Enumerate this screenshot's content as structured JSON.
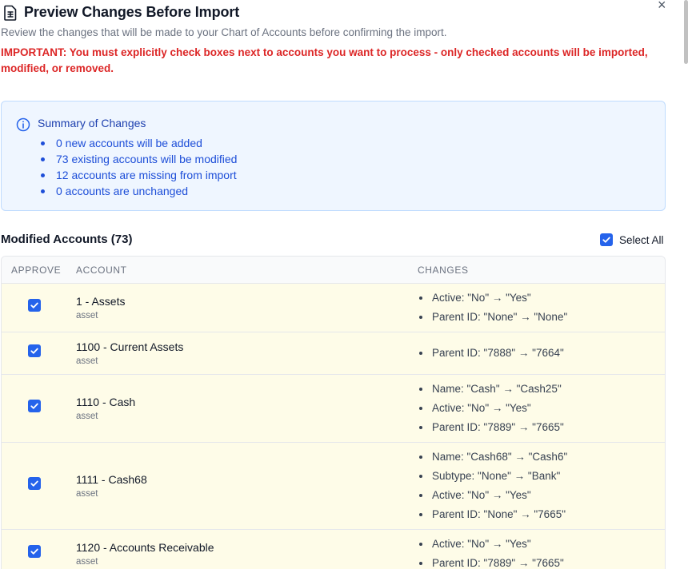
{
  "dialog": {
    "title": "Preview Changes Before Import",
    "close_label": "×",
    "subtitle": "Review the changes that will be made to your Chart of Accounts before confirming the import.",
    "important": "IMPORTANT: You must explicitly check boxes next to accounts you want to process - only checked accounts will be imported, modified, or removed."
  },
  "summary": {
    "title": "Summary of Changes",
    "items": [
      "0 new accounts will be added",
      "73 existing accounts will be modified",
      "12 accounts are missing from import",
      "0 accounts are unchanged"
    ]
  },
  "modified": {
    "title": "Modified Accounts (73)",
    "select_all_label": "Select All",
    "select_all_checked": true,
    "columns": [
      "APPROVE",
      "ACCOUNT",
      "CHANGES"
    ],
    "rows": [
      {
        "name": "1 - Assets",
        "type": "asset",
        "checked": true,
        "changes": [
          "Active: \"No\" → \"Yes\"",
          "Parent ID: \"None\" → \"None\""
        ]
      },
      {
        "name": "1100 - Current Assets",
        "type": "asset",
        "checked": true,
        "changes": [
          "Parent ID: \"7888\" → \"7664\""
        ]
      },
      {
        "name": "1110 - Cash",
        "type": "asset",
        "checked": true,
        "changes": [
          "Name: \"Cash\" → \"Cash25\"",
          "Active: \"No\" → \"Yes\"",
          "Parent ID: \"7889\" → \"7665\""
        ]
      },
      {
        "name": "1111 - Cash68",
        "type": "asset",
        "checked": true,
        "changes": [
          "Name: \"Cash68\" → \"Cash6\"",
          "Subtype: \"None\" → \"Bank\"",
          "Active: \"No\" → \"Yes\"",
          "Parent ID: \"None\" → \"7665\""
        ]
      },
      {
        "name": "1120 - Accounts Receivable",
        "type": "asset",
        "checked": true,
        "changes": [
          "Active: \"No\" → \"Yes\"",
          "Parent ID: \"7889\" → \"7665\""
        ]
      }
    ]
  },
  "colors": {
    "accent": "#2563eb",
    "important": "#dc2626",
    "summary_bg": "#eff6ff",
    "row_bg": "#fefce8"
  },
  "icons": {
    "title": "document-icon",
    "summary": "info-icon",
    "checkbox": "check-icon"
  }
}
